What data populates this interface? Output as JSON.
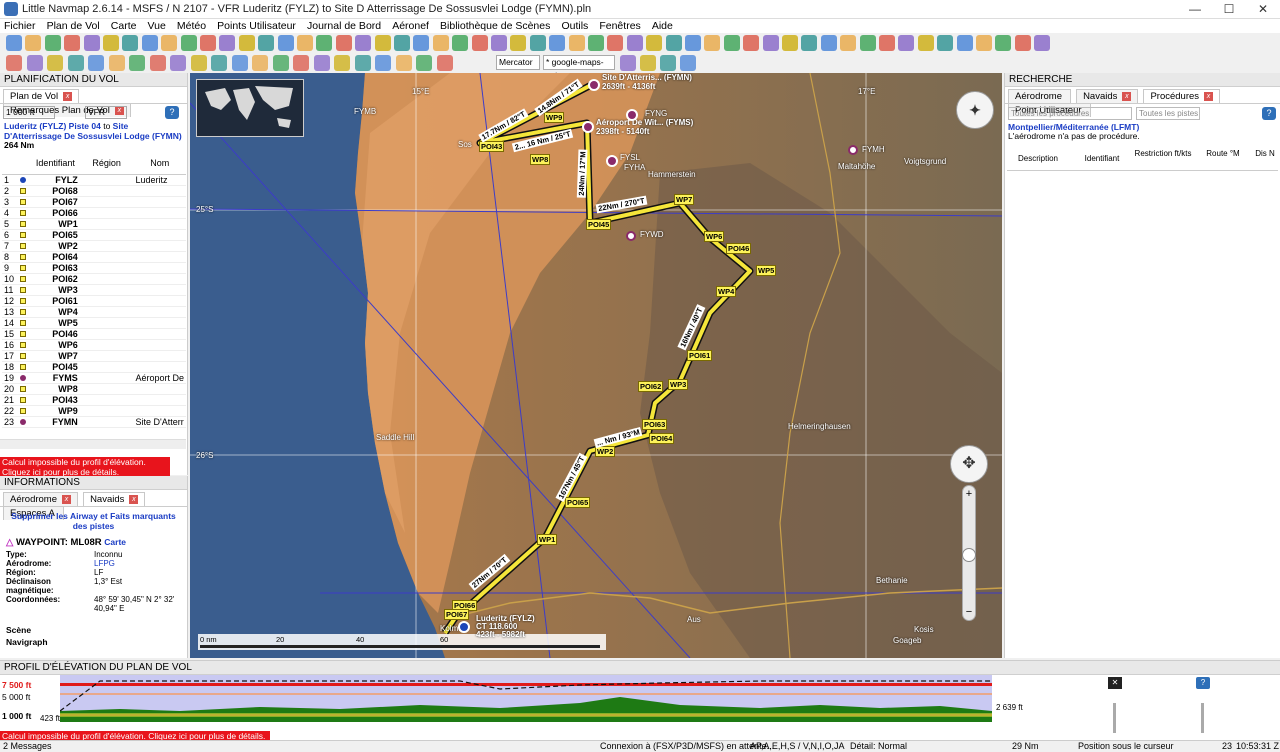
{
  "window": {
    "title": "Little Navmap 2.6.14 - MSFS / N 2107 - VFR Luderitz (FYLZ) to Site D Atterrissage De Sossusvlei Lodge (FYMN).pln",
    "controls": [
      "—",
      "☐",
      "✕"
    ]
  },
  "menu": [
    "Fichier",
    "Plan de Vol",
    "Carte",
    "Vue",
    "Météo",
    "Points Utilisateur",
    "Journal de Bord",
    "Aéronef",
    "Bibliothèque de Scènes",
    "Outils",
    "Fenêtres",
    "Aide"
  ],
  "map_controls": {
    "projection": "Mercator",
    "theme": "* google-maps-sat"
  },
  "flight_plan_panel": {
    "title": "PLANIFICATION DU VOL",
    "tabs": [
      "Plan de Vol",
      "Remarques Plan de Vol"
    ],
    "altitude": "1 000 ft",
    "rules": "VFR",
    "route_from": "Luderitz (FYLZ) Piste 04",
    "route_to_word": "to",
    "route_dest": "Site D'Atterrissage De Sossusvlei Lodge (FYMN)",
    "distance": "264 Nm",
    "columns": [
      "Identifiant",
      "Région",
      "Nom"
    ],
    "rows": [
      {
        "n": "1",
        "id": "FYLZ",
        "region": "",
        "name": "Luderitz",
        "kind": "airport"
      },
      {
        "n": "2",
        "id": "POI68",
        "region": "",
        "name": "",
        "kind": "wp"
      },
      {
        "n": "3",
        "id": "POI67",
        "region": "",
        "name": "",
        "kind": "wp"
      },
      {
        "n": "4",
        "id": "POI66",
        "region": "",
        "name": "",
        "kind": "wp"
      },
      {
        "n": "5",
        "id": "WP1",
        "region": "",
        "name": "",
        "kind": "wp"
      },
      {
        "n": "6",
        "id": "POI65",
        "region": "",
        "name": "",
        "kind": "wp"
      },
      {
        "n": "7",
        "id": "WP2",
        "region": "",
        "name": "",
        "kind": "wp"
      },
      {
        "n": "8",
        "id": "POI64",
        "region": "",
        "name": "",
        "kind": "wp"
      },
      {
        "n": "9",
        "id": "POI63",
        "region": "",
        "name": "",
        "kind": "wp"
      },
      {
        "n": "10",
        "id": "POI62",
        "region": "",
        "name": "",
        "kind": "wp"
      },
      {
        "n": "11",
        "id": "WP3",
        "region": "",
        "name": "",
        "kind": "wp"
      },
      {
        "n": "12",
        "id": "POI61",
        "region": "",
        "name": "",
        "kind": "wp"
      },
      {
        "n": "13",
        "id": "WP4",
        "region": "",
        "name": "",
        "kind": "wp"
      },
      {
        "n": "14",
        "id": "WP5",
        "region": "",
        "name": "",
        "kind": "wp"
      },
      {
        "n": "15",
        "id": "POI46",
        "region": "",
        "name": "",
        "kind": "wp"
      },
      {
        "n": "16",
        "id": "WP6",
        "region": "",
        "name": "",
        "kind": "wp"
      },
      {
        "n": "17",
        "id": "WP7",
        "region": "",
        "name": "",
        "kind": "wp"
      },
      {
        "n": "18",
        "id": "POI45",
        "region": "",
        "name": "",
        "kind": "wp"
      },
      {
        "n": "19",
        "id": "FYMS",
        "region": "",
        "name": "Aéroport De",
        "kind": "airport2"
      },
      {
        "n": "20",
        "id": "WP8",
        "region": "",
        "name": "",
        "kind": "wp"
      },
      {
        "n": "21",
        "id": "POI43",
        "region": "",
        "name": "",
        "kind": "wp"
      },
      {
        "n": "22",
        "id": "WP9",
        "region": "",
        "name": "",
        "kind": "wp"
      },
      {
        "n": "23",
        "id": "FYMN",
        "region": "",
        "name": "Site D'Atterr",
        "kind": "airport2"
      }
    ],
    "error": "Calcul impossible du profil d'élévation. Cliquez ici pour plus de détails."
  },
  "info_panel": {
    "title": "INFORMATIONS",
    "tabs": [
      "Aérodrome",
      "Navaids",
      "Espaces A"
    ],
    "link": "Supprimer les Airway et Faits marquants des pistes",
    "waypoint_title": "WAYPOINT: ML08R",
    "waypoint_link": "Carte",
    "fields": [
      {
        "label": "Type:",
        "value": "Inconnu"
      },
      {
        "label": "Aérodrome:",
        "value": "LFPG"
      },
      {
        "label": "Région:",
        "value": "LF"
      },
      {
        "label": "Déclinaison magnétique:",
        "value": "1,3° Est"
      },
      {
        "label": "Coordonnées:",
        "value": "48° 59' 30,45\" N 2° 32' 40,94\" E"
      }
    ],
    "section_scene": "Scène",
    "section_nav": "Navigraph"
  },
  "search_panel": {
    "title": "RECHERCHE",
    "tabs": [
      "Aérodrome",
      "Navaids",
      "Procédures",
      "Point Utilisateur"
    ],
    "filter1": "Toutes les procédures",
    "filter2": "Toutes les pistes",
    "airport": "Montpellier/Méditerranée (LFMT)",
    "note": "L'aérodrome n'a pas de procédure.",
    "columns": [
      "Description",
      "Identifiant",
      "Restriction ft/kts",
      "Route °M",
      "Dis N"
    ]
  },
  "map": {
    "labels": {
      "lon15": "15°E",
      "lon17": "17°E",
      "lat25": "25°S",
      "lat26": "26°S",
      "fymb": "FYMB",
      "fymn": "Site D'Atterris... (FYMN)",
      "fymn2": "2639ft - 4136ft",
      "fyms": "Aéroport De Wit... (FYMS)",
      "fyms2": "2398ft - 5140ft",
      "fyng": "FYNG",
      "fysl": "FYSL",
      "fyha": "FYHA",
      "fywd": "FYWD",
      "fymh": "FYMH",
      "maltahohe": "Maltahöhe",
      "voigtsgrund": "Voigtsgrund",
      "hammerstein": "Hammerstein",
      "helmeringhausen": "Helmeringhausen",
      "bethanie": "Bethanie",
      "goageb": "Goageb",
      "kosis": "Kosis",
      "aus": "Aus",
      "saddlehill": "Saddle Hill",
      "kolm": "Kolm...",
      "fylz1": "Luderitz (FYLZ)",
      "fylz2": "CT 118.600",
      "fylz3": "423ft - 5982ft",
      "sos": "Sos",
      "scale0": "0 nm",
      "scale20": "20",
      "scale40": "40",
      "scale60": "60"
    },
    "legs": [
      "27Nm / 70°T",
      "167Nm / 45°T",
      "... Nm / 93°M",
      "16Nm / 40°T",
      "22Nm / 270°T",
      "24Nm / 17°M",
      "2... 16 Nm / 25°T",
      "17.7Nm / 82°T",
      "14.8Nm / 71°T"
    ]
  },
  "profile_panel": {
    "title": "PROFIL D'ÉLÉVATION DU PLAN DE VOL",
    "y_top": "7 500 ft",
    "y_mid": "5 000 ft",
    "y_bot": "1 000 ft",
    "start_alt": "423 ft",
    "end_alt": "2 639 ft",
    "error": "Calcul impossible du profil d'élévation. Cliquez ici pour plus de détails."
  },
  "status": {
    "messages": "2 Messages",
    "connection": "Connexion à (FSX/P3D/MSFS) en attente...",
    "filters": "AP,A,E,H,S / V,N,I,O,JA",
    "detail": "Détail: Normal",
    "distance": "29 Nm",
    "cursor": "Position sous le curseur",
    "zoom": "23",
    "time": "10:53:31 Z"
  }
}
